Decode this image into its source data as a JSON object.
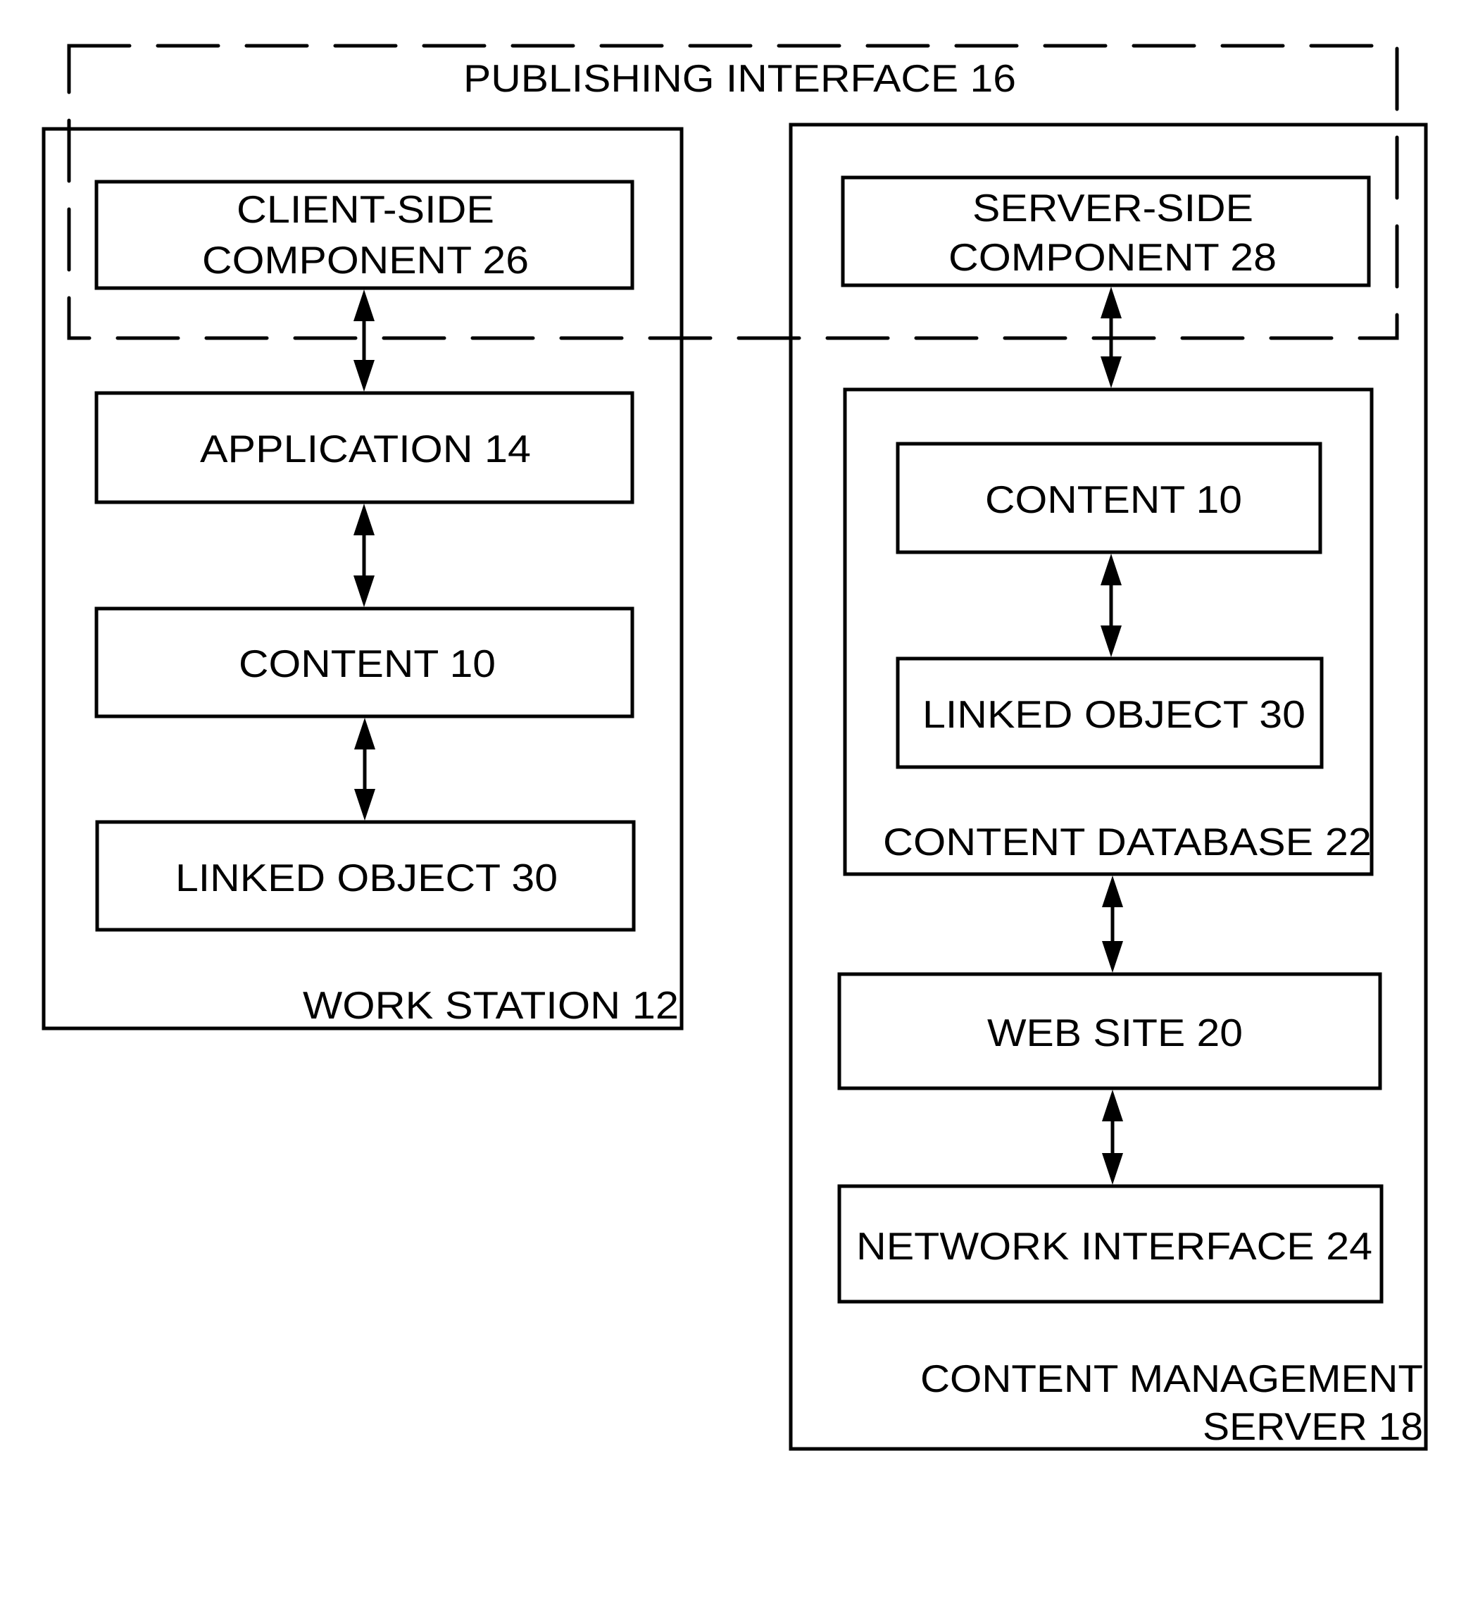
{
  "figure": {
    "publishing_interface": {
      "label": "PUBLISHING INTERFACE 16"
    },
    "work_station": {
      "label": "WORK STATION 12",
      "blocks": {
        "client_side": {
          "line1": "CLIENT-SIDE",
          "line2": "COMPONENT 26"
        },
        "application": {
          "label": "APPLICATION 14"
        },
        "content": {
          "label": "CONTENT 10"
        },
        "linked_object": {
          "label": "LINKED OBJECT 30"
        }
      }
    },
    "content_management_server": {
      "label_line1": "CONTENT MANAGEMENT",
      "label_line2": "SERVER 18",
      "blocks": {
        "server_side": {
          "line1": "SERVER-SIDE",
          "line2": "COMPONENT 28"
        },
        "content_database": {
          "label": "CONTENT DATABASE 22",
          "content": {
            "label": "CONTENT 10"
          },
          "linked_object": {
            "label": "LINKED OBJECT 30"
          }
        },
        "web_site": {
          "label": "WEB SITE 20"
        },
        "network_interface": {
          "label": "NETWORK INTERFACE 24"
        }
      }
    },
    "connections": [
      {
        "from": "CLIENT-SIDE COMPONENT 26",
        "to": "APPLICATION 14",
        "type": "bidirectional"
      },
      {
        "from": "APPLICATION 14",
        "to": "CONTENT 10",
        "type": "bidirectional"
      },
      {
        "from": "CONTENT 10",
        "to": "LINKED OBJECT 30",
        "type": "bidirectional"
      },
      {
        "from": "SERVER-SIDE COMPONENT 28",
        "to": "CONTENT DATABASE 22",
        "type": "bidirectional"
      },
      {
        "from": "CONTENT 10",
        "to": "LINKED OBJECT 30",
        "type": "bidirectional"
      },
      {
        "from": "CONTENT DATABASE 22",
        "to": "WEB SITE 20",
        "type": "bidirectional"
      },
      {
        "from": "WEB SITE 20",
        "to": "NETWORK INTERFACE 24",
        "type": "bidirectional"
      }
    ]
  }
}
